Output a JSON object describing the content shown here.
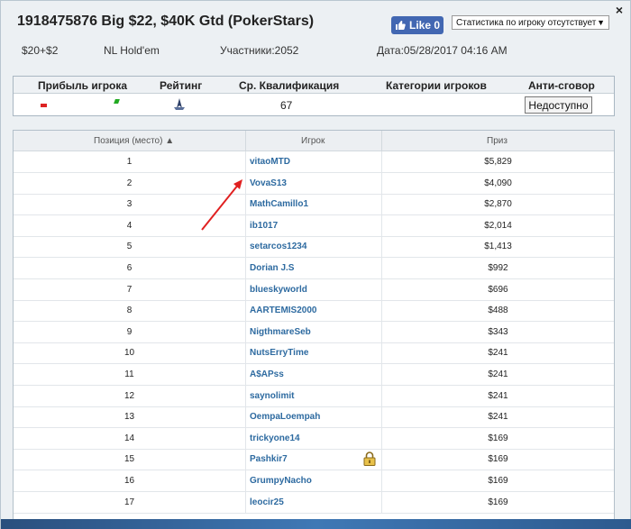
{
  "header": {
    "title": "1918475876 Big $22, $40K Gtd (PokerStars)",
    "like_label": "Like 0",
    "stats_select": "Статистика по игроку отсутствует",
    "close_symbol": "×",
    "buyin": "$20+$2",
    "game": "NL Hold'em",
    "participants": "Участники:2052",
    "date": "Дата:05/28/2017 04:16 AM"
  },
  "summary": {
    "col_profit": "Прибыль игрока",
    "col_rating": "Рейтинг",
    "col_avg": "Ср. Квалификация",
    "col_categories": "Категории игроков",
    "col_anticollusion": "Анти-сговор",
    "avg_value": "67",
    "anticollusion_button": "Недоступно"
  },
  "results": {
    "col_position": "Позиция (место)",
    "col_player": "Игрок",
    "col_prize": "Приз",
    "rows": [
      {
        "pos": "1",
        "player": "vitaoMTD",
        "prize": "$5,829"
      },
      {
        "pos": "2",
        "player": "VovaS13",
        "prize": "$4,090"
      },
      {
        "pos": "3",
        "player": "MathCamillo1",
        "prize": "$2,870"
      },
      {
        "pos": "4",
        "player": "ib1017",
        "prize": "$2,014"
      },
      {
        "pos": "5",
        "player": "setarcos1234",
        "prize": "$1,413"
      },
      {
        "pos": "6",
        "player": "Dorian J.S",
        "prize": "$992"
      },
      {
        "pos": "7",
        "player": "blueskyworld",
        "prize": "$696"
      },
      {
        "pos": "8",
        "player": "AARTEMIS2000",
        "prize": "$488"
      },
      {
        "pos": "9",
        "player": "NigthmareSeb",
        "prize": "$343"
      },
      {
        "pos": "10",
        "player": "NutsErryTime",
        "prize": "$241"
      },
      {
        "pos": "11",
        "player": "A$APss",
        "prize": "$241"
      },
      {
        "pos": "12",
        "player": "saynolimit",
        "prize": "$241"
      },
      {
        "pos": "13",
        "player": "OempaLoempah",
        "prize": "$241"
      },
      {
        "pos": "14",
        "player": "trickyone14",
        "prize": "$169"
      },
      {
        "pos": "15",
        "player": "Pashkir7",
        "prize": "$169"
      },
      {
        "pos": "16",
        "player": "GrumpyNacho",
        "prize": "$169"
      },
      {
        "pos": "17",
        "player": "leocir25",
        "prize": "$169"
      }
    ]
  },
  "icons": {
    "close": "close-icon",
    "like": "thumbs-up-icon",
    "dropdown": "chevron-down-icon",
    "rating": "rating-icon",
    "lock": "lock-icon",
    "sort": "sort-up-icon"
  },
  "colors": {
    "player_link": "#2d6aa0",
    "like_button": "#4267b2",
    "annotation_arrow": "#e02020"
  }
}
